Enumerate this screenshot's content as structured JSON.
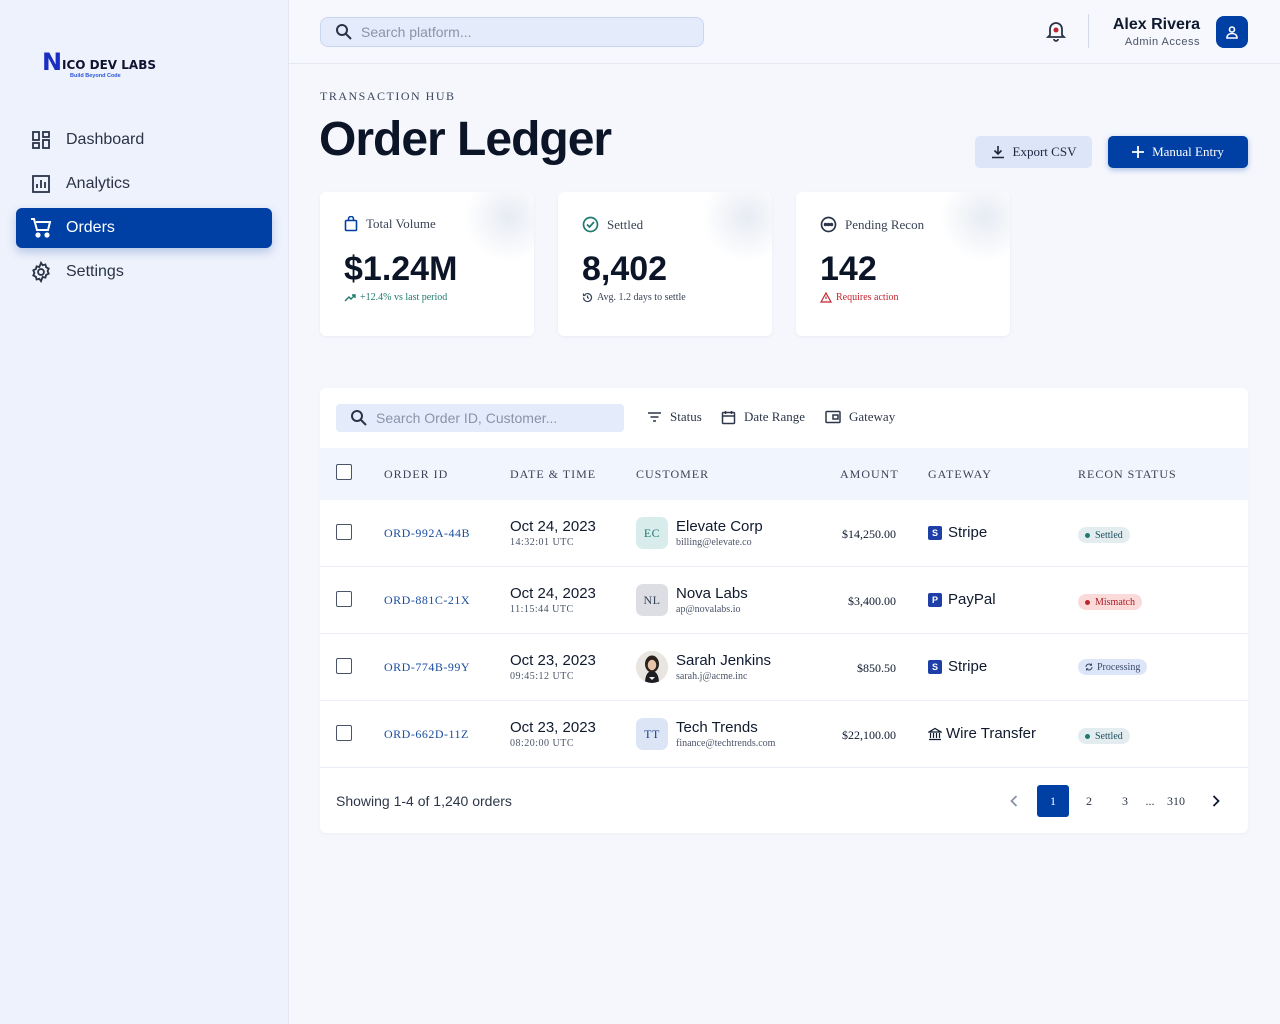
{
  "brand": {
    "logo_n": "N",
    "logo_text": "ICO DEV LABS",
    "tagline": "Build Beyond Code"
  },
  "sidebar": {
    "items": [
      {
        "label": "Dashboard",
        "icon": "dashboard-icon",
        "active": false
      },
      {
        "label": "Analytics",
        "icon": "analytics-icon",
        "active": false
      },
      {
        "label": "Orders",
        "icon": "cart-icon",
        "active": true
      },
      {
        "label": "Settings",
        "icon": "gear-icon",
        "active": false
      }
    ]
  },
  "topbar": {
    "search_placeholder": "Search platform...",
    "user_name": "Alex Rivera",
    "user_role": "Admin Access"
  },
  "header": {
    "eyebrow": "TRANSACTION HUB",
    "title": "Order Ledger",
    "export_label": "Export CSV",
    "manual_label": "Manual Entry"
  },
  "stats": [
    {
      "label": "Total Volume",
      "value": "$1.24M",
      "sub": "+12.4% vs last period",
      "sub_color": "#1f7a6e"
    },
    {
      "label": "Settled",
      "value": "8,402",
      "sub": "Avg. 1.2 days to settle",
      "sub_color": "#3a4457"
    },
    {
      "label": "Pending Recon",
      "value": "142",
      "sub": "Requires action",
      "sub_color": "#c0262d"
    }
  ],
  "table": {
    "search_placeholder": "Search Order ID, Customer...",
    "filters": [
      "Status",
      "Date Range",
      "Gateway"
    ],
    "columns": [
      "ORDER ID",
      "DATE & TIME",
      "CUSTOMER",
      "AMOUNT",
      "GATEWAY",
      "RECON STATUS"
    ],
    "rows": [
      {
        "id": "ORD-992A-44B",
        "date": "Oct 24, 2023",
        "time": "14:32:01 UTC",
        "initials": "EC",
        "customer": "Elevate Corp",
        "email": "billing@elevate.co",
        "amount": "$14,250.00",
        "gateway": "Stripe",
        "gw_badge": "S",
        "status": "Settled"
      },
      {
        "id": "ORD-881C-21X",
        "date": "Oct 24, 2023",
        "time": "11:15:44 UTC",
        "initials": "NL",
        "customer": "Nova Labs",
        "email": "ap@novalabs.io",
        "amount": "$3,400.00",
        "gateway": "PayPal",
        "gw_badge": "P",
        "status": "Mismatch"
      },
      {
        "id": "ORD-774B-99Y",
        "date": "Oct 23, 2023",
        "time": "09:45:12 UTC",
        "initials": "",
        "customer": "Sarah Jenkins",
        "email": "sarah.j@acme.inc",
        "amount": "$850.50",
        "gateway": "Stripe",
        "gw_badge": "S",
        "status": "Processing"
      },
      {
        "id": "ORD-662D-11Z",
        "date": "Oct 23, 2023",
        "time": "08:20:00 UTC",
        "initials": "TT",
        "customer": "Tech Trends",
        "email": "finance@techtrends.com",
        "amount": "$22,100.00",
        "gateway": "Wire Transfer",
        "gw_badge": "",
        "status": "Settled"
      }
    ],
    "footer": "Showing 1-4 of 1,240 orders",
    "pages": [
      "1",
      "2",
      "3",
      "...",
      "310"
    ]
  },
  "colors": {
    "primary": "#003fa3",
    "settled_bg": "#e3edf0",
    "settled_dot": "#1f7a6e",
    "mismatch_bg": "#fbdada",
    "mismatch_dot": "#c0262d",
    "processing_bg": "#dde6f8"
  }
}
